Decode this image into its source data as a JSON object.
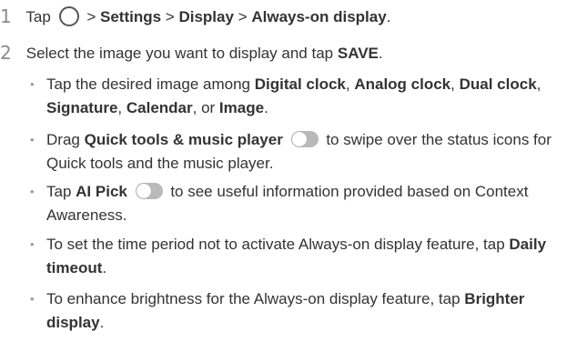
{
  "step1": {
    "number": "1",
    "tap": "Tap",
    "sep": ">",
    "settings": "Settings",
    "display": "Display",
    "always_on": "Always-on display",
    "end": ".",
    "home_icon": "home-circle-icon"
  },
  "step2": {
    "number": "2",
    "text": "Select the image you want to display and tap",
    "save": "SAVE",
    "end": "."
  },
  "bullets": [
    {
      "t1": "Tap the desired image among",
      "b1": "Digital clock",
      "c1": ",",
      "b2": "Analog clock",
      "c2": ",",
      "b3": "Dual clock",
      "c3": ",",
      "b4": "Signature",
      "c4": ",",
      "b5": "Calendar",
      "c5": ", or",
      "b6": "Image",
      "end": "."
    },
    {
      "t1": "Drag",
      "b1": "Quick tools & music player",
      "t2": "to swipe over the status icons for Quick tools and the music player."
    },
    {
      "t1": "Tap",
      "b1": "AI Pick",
      "t2": "to see useful information provided based on Context Awareness."
    },
    {
      "t1": "To set the time period not to activate Always-on display feature, tap",
      "b1": "Daily timeout",
      "end": "."
    },
    {
      "t1": "To enhance brightness for the Always-on display feature, tap",
      "b1": "Brighter display",
      "end": "."
    }
  ],
  "bullet_symbol": "•",
  "colors": {
    "text": "#333333",
    "toggle": "#b9b9b9",
    "step_number": "#8a8a8a"
  }
}
